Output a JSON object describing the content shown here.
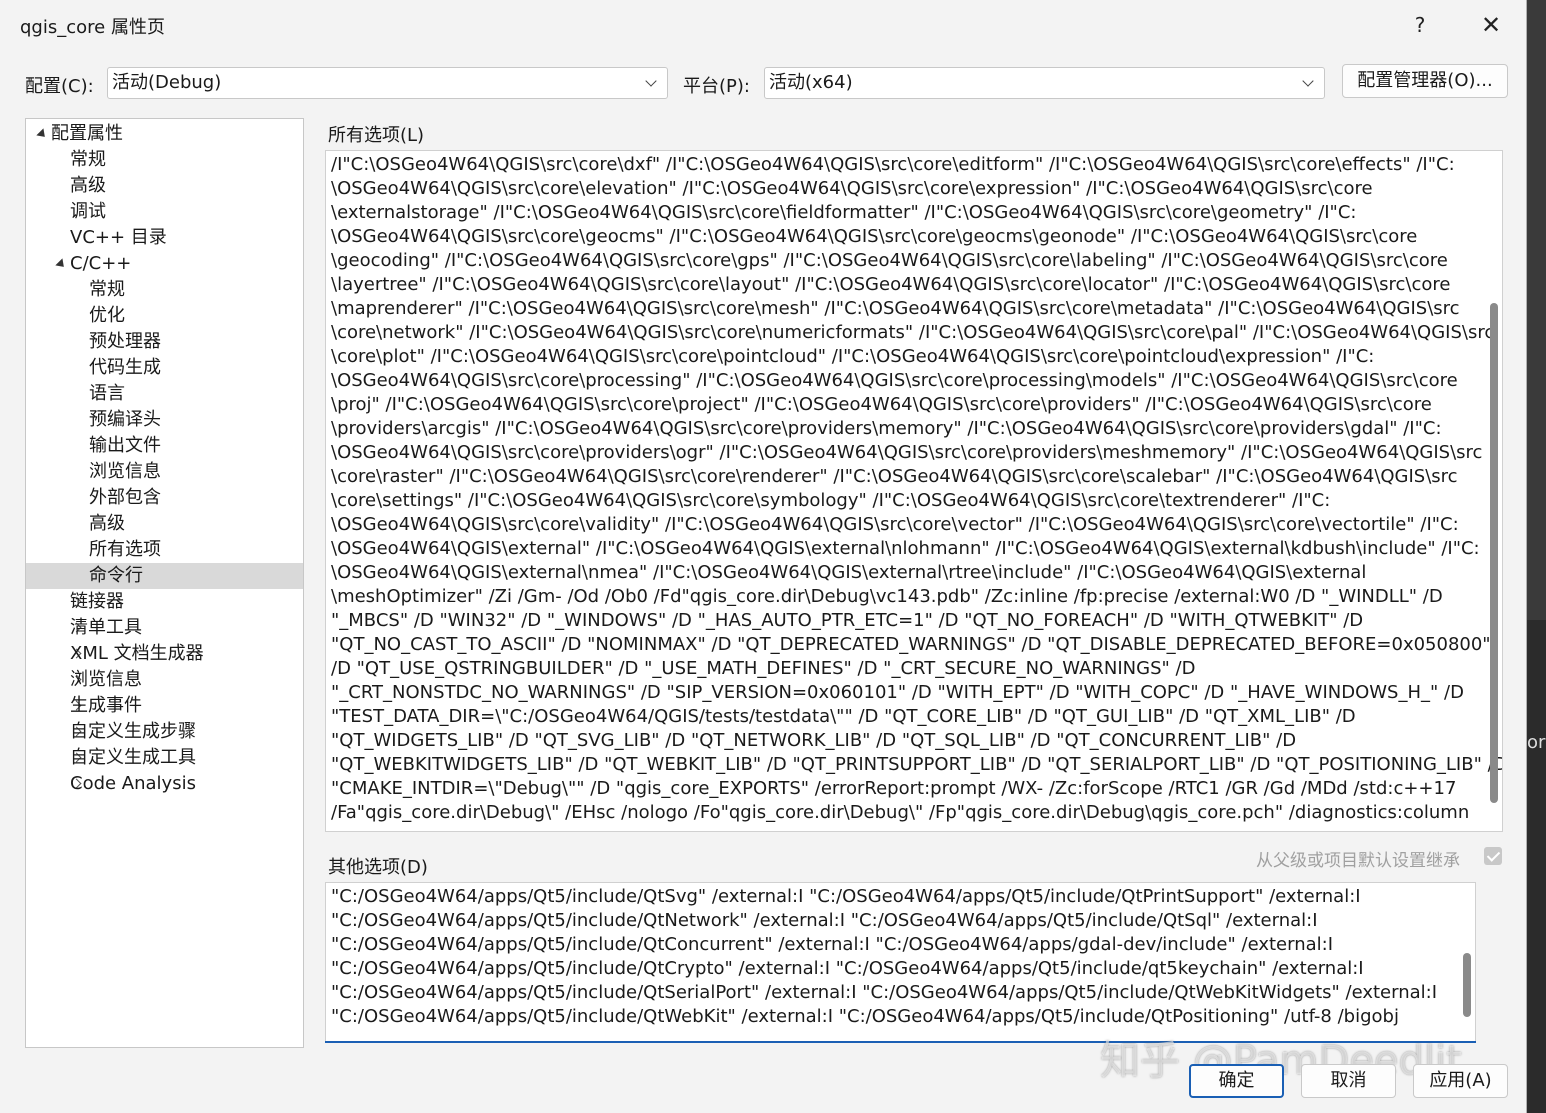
{
  "window": {
    "title": "qgis_core 属性页",
    "help_label": "?",
    "close_label": "✕"
  },
  "config_bar": {
    "config_label": "配置(C):",
    "config_value": "活动(Debug)",
    "platform_label": "平台(P):",
    "platform_value": "活动(x64)",
    "manager_button": "配置管理器(O)..."
  },
  "tree": {
    "items": [
      {
        "label": "配置属性",
        "level": 0,
        "toggle": "down"
      },
      {
        "label": "常规",
        "level": 1,
        "toggle": ""
      },
      {
        "label": "高级",
        "level": 1,
        "toggle": ""
      },
      {
        "label": "调试",
        "level": 1,
        "toggle": ""
      },
      {
        "label": "VC++ 目录",
        "level": 1,
        "toggle": ""
      },
      {
        "label": "C/C++",
        "level": 1,
        "toggle": "down"
      },
      {
        "label": "常规",
        "level": 2,
        "toggle": ""
      },
      {
        "label": "优化",
        "level": 2,
        "toggle": ""
      },
      {
        "label": "预处理器",
        "level": 2,
        "toggle": ""
      },
      {
        "label": "代码生成",
        "level": 2,
        "toggle": ""
      },
      {
        "label": "语言",
        "level": 2,
        "toggle": ""
      },
      {
        "label": "预编译头",
        "level": 2,
        "toggle": ""
      },
      {
        "label": "输出文件",
        "level": 2,
        "toggle": ""
      },
      {
        "label": "浏览信息",
        "level": 2,
        "toggle": ""
      },
      {
        "label": "外部包含",
        "level": 2,
        "toggle": ""
      },
      {
        "label": "高级",
        "level": 2,
        "toggle": ""
      },
      {
        "label": "所有选项",
        "level": 2,
        "toggle": ""
      },
      {
        "label": "命令行",
        "level": 2,
        "toggle": "",
        "selected": true
      },
      {
        "label": "链接器",
        "level": 1,
        "toggle": "right"
      },
      {
        "label": "清单工具",
        "level": 1,
        "toggle": "right"
      },
      {
        "label": "XML 文档生成器",
        "level": 1,
        "toggle": "right"
      },
      {
        "label": "浏览信息",
        "level": 1,
        "toggle": "right"
      },
      {
        "label": "生成事件",
        "level": 1,
        "toggle": "right"
      },
      {
        "label": "自定义生成步骤",
        "level": 1,
        "toggle": "right"
      },
      {
        "label": "自定义生成工具",
        "level": 1,
        "toggle": "right"
      },
      {
        "label": "Code Analysis",
        "level": 1,
        "toggle": "right"
      }
    ]
  },
  "all_options": {
    "label": "所有选项(L)",
    "lines": [
      "/I\"C:\\OSGeo4W64\\QGIS\\src\\core\\dxf\" /I\"C:\\OSGeo4W64\\QGIS\\src\\core\\editform\" /I\"C:\\OSGeo4W64\\QGIS\\src\\core\\effects\" /I\"C:",
      "\\OSGeo4W64\\QGIS\\src\\core\\elevation\" /I\"C:\\OSGeo4W64\\QGIS\\src\\core\\expression\" /I\"C:\\OSGeo4W64\\QGIS\\src\\core",
      "\\externalstorage\" /I\"C:\\OSGeo4W64\\QGIS\\src\\core\\fieldformatter\" /I\"C:\\OSGeo4W64\\QGIS\\src\\core\\geometry\" /I\"C:",
      "\\OSGeo4W64\\QGIS\\src\\core\\geocms\" /I\"C:\\OSGeo4W64\\QGIS\\src\\core\\geocms\\geonode\" /I\"C:\\OSGeo4W64\\QGIS\\src\\core",
      "\\geocoding\" /I\"C:\\OSGeo4W64\\QGIS\\src\\core\\gps\" /I\"C:\\OSGeo4W64\\QGIS\\src\\core\\labeling\" /I\"C:\\OSGeo4W64\\QGIS\\src\\core",
      "\\layertree\" /I\"C:\\OSGeo4W64\\QGIS\\src\\core\\layout\" /I\"C:\\OSGeo4W64\\QGIS\\src\\core\\locator\" /I\"C:\\OSGeo4W64\\QGIS\\src\\core",
      "\\maprenderer\" /I\"C:\\OSGeo4W64\\QGIS\\src\\core\\mesh\" /I\"C:\\OSGeo4W64\\QGIS\\src\\core\\metadata\" /I\"C:\\OSGeo4W64\\QGIS\\src",
      "\\core\\network\" /I\"C:\\OSGeo4W64\\QGIS\\src\\core\\numericformats\" /I\"C:\\OSGeo4W64\\QGIS\\src\\core\\pal\" /I\"C:\\OSGeo4W64\\QGIS\\src",
      "\\core\\plot\" /I\"C:\\OSGeo4W64\\QGIS\\src\\core\\pointcloud\" /I\"C:\\OSGeo4W64\\QGIS\\src\\core\\pointcloud\\expression\" /I\"C:",
      "\\OSGeo4W64\\QGIS\\src\\core\\processing\" /I\"C:\\OSGeo4W64\\QGIS\\src\\core\\processing\\models\" /I\"C:\\OSGeo4W64\\QGIS\\src\\core",
      "\\proj\" /I\"C:\\OSGeo4W64\\QGIS\\src\\core\\project\" /I\"C:\\OSGeo4W64\\QGIS\\src\\core\\providers\" /I\"C:\\OSGeo4W64\\QGIS\\src\\core",
      "\\providers\\arcgis\" /I\"C:\\OSGeo4W64\\QGIS\\src\\core\\providers\\memory\" /I\"C:\\OSGeo4W64\\QGIS\\src\\core\\providers\\gdal\" /I\"C:",
      "\\OSGeo4W64\\QGIS\\src\\core\\providers\\ogr\" /I\"C:\\OSGeo4W64\\QGIS\\src\\core\\providers\\meshmemory\" /I\"C:\\OSGeo4W64\\QGIS\\src",
      "\\core\\raster\" /I\"C:\\OSGeo4W64\\QGIS\\src\\core\\renderer\" /I\"C:\\OSGeo4W64\\QGIS\\src\\core\\scalebar\" /I\"C:\\OSGeo4W64\\QGIS\\src",
      "\\core\\settings\" /I\"C:\\OSGeo4W64\\QGIS\\src\\core\\symbology\" /I\"C:\\OSGeo4W64\\QGIS\\src\\core\\textrenderer\" /I\"C:",
      "\\OSGeo4W64\\QGIS\\src\\core\\validity\" /I\"C:\\OSGeo4W64\\QGIS\\src\\core\\vector\" /I\"C:\\OSGeo4W64\\QGIS\\src\\core\\vectortile\" /I\"C:",
      "\\OSGeo4W64\\QGIS\\external\" /I\"C:\\OSGeo4W64\\QGIS\\external\\nlohmann\" /I\"C:\\OSGeo4W64\\QGIS\\external\\kdbush\\include\" /I\"C:",
      "\\OSGeo4W64\\QGIS\\external\\nmea\" /I\"C:\\OSGeo4W64\\QGIS\\external\\rtree\\include\" /I\"C:\\OSGeo4W64\\QGIS\\external",
      "\\meshOptimizer\" /Zi /Gm- /Od /Ob0 /Fd\"qgis_core.dir\\Debug\\vc143.pdb\" /Zc:inline /fp:precise /external:W0 /D \"_WINDLL\" /D",
      "\"_MBCS\" /D \"WIN32\" /D \"_WINDOWS\" /D \"_HAS_AUTO_PTR_ETC=1\" /D \"QT_NO_FOREACH\" /D \"WITH_QTWEBKIT\" /D",
      "\"QT_NO_CAST_TO_ASCII\" /D \"NOMINMAX\" /D \"QT_DEPRECATED_WARNINGS\" /D \"QT_DISABLE_DEPRECATED_BEFORE=0x050800\"",
      "/D \"QT_USE_QSTRINGBUILDER\" /D \"_USE_MATH_DEFINES\" /D \"_CRT_SECURE_NO_WARNINGS\" /D",
      "\"_CRT_NONSTDC_NO_WARNINGS\" /D \"SIP_VERSION=0x060101\" /D \"WITH_EPT\" /D \"WITH_COPC\" /D \"_HAVE_WINDOWS_H_\" /D",
      "\"TEST_DATA_DIR=\\\"C:/OSGeo4W64/QGIS/tests/testdata\\\"\" /D \"QT_CORE_LIB\" /D \"QT_GUI_LIB\" /D \"QT_XML_LIB\" /D",
      "\"QT_WIDGETS_LIB\" /D \"QT_SVG_LIB\" /D \"QT_NETWORK_LIB\" /D \"QT_SQL_LIB\" /D \"QT_CONCURRENT_LIB\" /D",
      "\"QT_WEBKITWIDGETS_LIB\" /D \"QT_WEBKIT_LIB\" /D \"QT_PRINTSUPPORT_LIB\" /D \"QT_SERIALPORT_LIB\" /D \"QT_POSITIONING_LIB\" /D",
      "\"CMAKE_INTDIR=\\\"Debug\\\"\" /D \"qgis_core_EXPORTS\" /errorReport:prompt /WX- /Zc:forScope /RTC1 /GR /Gd /MDd /std:c++17",
      "/Fa\"qgis_core.dir\\Debug\\\" /EHsc /nologo /Fo\"qgis_core.dir\\Debug\\\" /Fp\"qgis_core.dir\\Debug\\qgis_core.pch\" /diagnostics:column"
    ]
  },
  "other_options": {
    "label": "其他选项(D)",
    "inherit_label": "从父级或项目默认设置继承",
    "inherit_checked": true,
    "lines": [
      "\"C:/OSGeo4W64/apps/Qt5/include/QtSvg\" /external:I \"C:/OSGeo4W64/apps/Qt5/include/QtPrintSupport\" /external:I",
      "\"C:/OSGeo4W64/apps/Qt5/include/QtNetwork\" /external:I \"C:/OSGeo4W64/apps/Qt5/include/QtSql\" /external:I",
      "\"C:/OSGeo4W64/apps/Qt5/include/QtConcurrent\" /external:I \"C:/OSGeo4W64/apps/gdal-dev/include\" /external:I",
      "\"C:/OSGeo4W64/apps/Qt5/include/QtCrypto\" /external:I \"C:/OSGeo4W64/apps/Qt5/include/qt5keychain\" /external:I",
      "\"C:/OSGeo4W64/apps/Qt5/include/QtSerialPort\" /external:I \"C:/OSGeo4W64/apps/Qt5/include/QtWebKitWidgets\" /external:I",
      "\"C:/OSGeo4W64/apps/Qt5/include/QtWebKit\" /external:I \"C:/OSGeo4W64/apps/Qt5/include/QtPositioning\" /utf-8 /bigobj"
    ]
  },
  "buttons": {
    "ok": "确定",
    "cancel": "取消",
    "apply": "应用(A)"
  },
  "watermark": "知乎 @PamDeedlit",
  "background_edge_text": "ore"
}
